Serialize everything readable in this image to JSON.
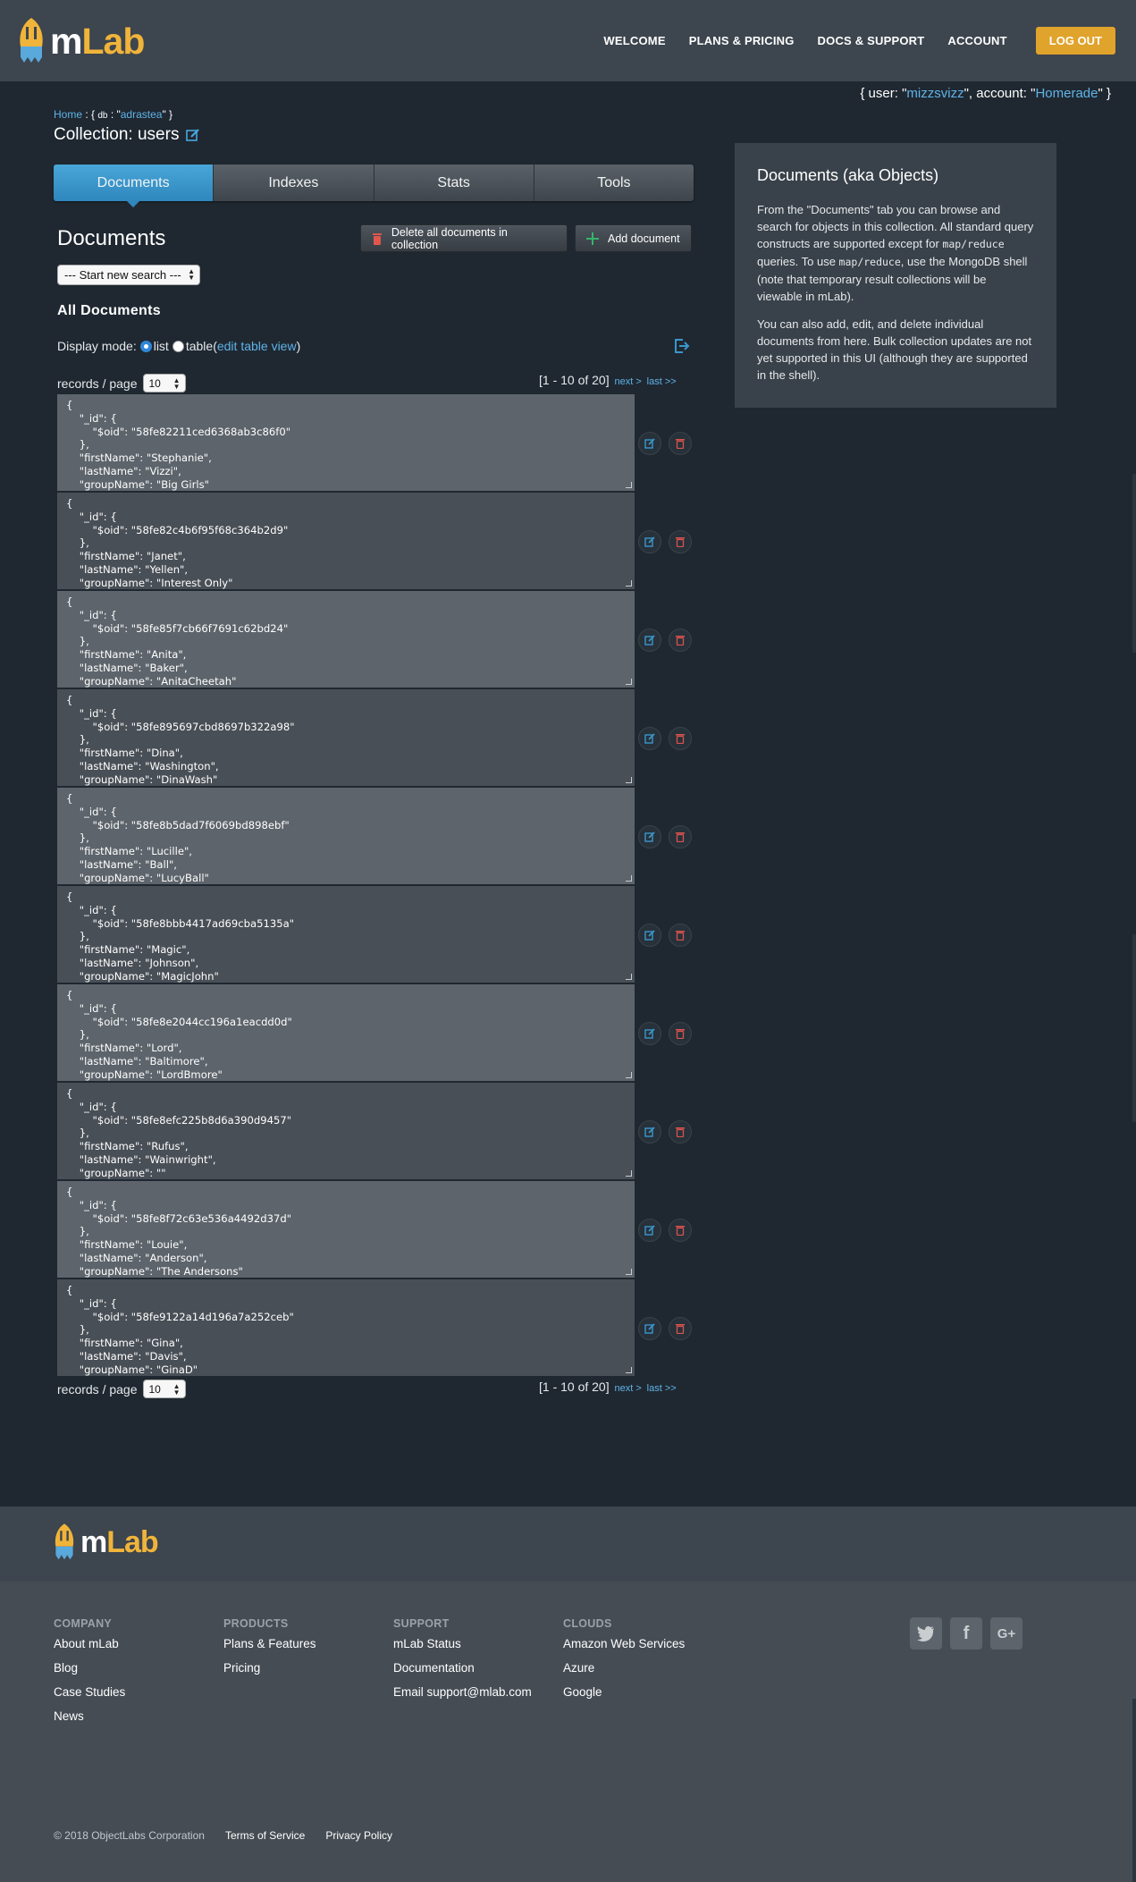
{
  "header": {
    "logo_m": "m",
    "logo_lab": "Lab",
    "nav": [
      "WELCOME",
      "PLANS & PRICING",
      "DOCS & SUPPORT",
      "ACCOUNT"
    ],
    "logout": "LOG OUT"
  },
  "user_line": {
    "prefix": "{ user: \"",
    "user": "mizzsvizz",
    "middle": "\", account: \"",
    "account": "Homerade",
    "suffix": "\" }"
  },
  "breadcrumb": {
    "home": "Home",
    "sep": " : { ",
    "db_label": "db",
    "db_mid": " : \"",
    "db": "adrastea",
    "end": "\" }"
  },
  "collection_title": "Collection: users",
  "tabs": [
    {
      "label": "Documents",
      "active": true
    },
    {
      "label": "Indexes",
      "active": false
    },
    {
      "label": "Stats",
      "active": false
    },
    {
      "label": "Tools",
      "active": false
    }
  ],
  "documents_heading": "Documents",
  "buttons": {
    "delete_all": "Delete all documents in collection",
    "add_document": "Add document"
  },
  "search_select": "--- Start new search ---",
  "all_documents": "All Documents",
  "display_mode": {
    "label": "Display mode:",
    "list": "list",
    "table": "table",
    "open_paren": " (",
    "edit_table_view": "edit table view",
    "close_paren": ")"
  },
  "records_per_page": {
    "label": "records / page",
    "value": "10"
  },
  "pager": {
    "range": "[1 - 10 of 20]",
    "next": "next >",
    "last": "last >>"
  },
  "documents": [
    {
      "oid": "58fe82211ced6368ab3c86f0",
      "firstName": "Stephanie",
      "lastName": "Vizzi",
      "groupName": "Big Girls"
    },
    {
      "oid": "58fe82c4b6f95f68c364b2d9",
      "firstName": "Janet",
      "lastName": "Yellen",
      "groupName": "Interest Only"
    },
    {
      "oid": "58fe85f7cb66f7691c62bd24",
      "firstName": "Anita",
      "lastName": "Baker",
      "groupName": "AnitaCheetah"
    },
    {
      "oid": "58fe895697cbd8697b322a98",
      "firstName": "Dina",
      "lastName": "Washington",
      "groupName": "DinaWash"
    },
    {
      "oid": "58fe8b5dad7f6069bd898ebf",
      "firstName": "Lucille",
      "lastName": "Ball",
      "groupName": "LucyBall"
    },
    {
      "oid": "58fe8bbb4417ad69cba5135a",
      "firstName": "Magic",
      "lastName": "Johnson",
      "groupName": "MagicJohn"
    },
    {
      "oid": "58fe8e2044cc196a1eacdd0d",
      "firstName": "Lord",
      "lastName": "Baltimore",
      "groupName": "LordBmore"
    },
    {
      "oid": "58fe8efc225b8d6a390d9457",
      "firstName": "Rufus",
      "lastName": "Wainwright",
      "groupName": ""
    },
    {
      "oid": "58fe8f72c63e536a4492d37d",
      "firstName": "Louie",
      "lastName": "Anderson",
      "groupName": "The Andersons"
    },
    {
      "oid": "58fe9122a14d196a7a252ceb",
      "firstName": "Gina",
      "lastName": "Davis",
      "groupName": "GinaD"
    }
  ],
  "sidebar": {
    "title": "Documents (aka Objects)",
    "p1_a": "From the \"Documents\" tab you can browse and search for objects in this collection. All standard query constructs are supported except for ",
    "p1_code1": "map/reduce",
    "p1_b": " queries. To use ",
    "p1_code2": "map/reduce",
    "p1_c": ", use the MongoDB shell (note that temporary result collections will be viewable in mLab).",
    "p2": "You can also add, edit, and delete individual documents from here. Bulk collection updates are not yet supported in this UI (although they are supported in the shell)."
  },
  "footer": {
    "columns": [
      {
        "title": "COMPANY",
        "links": [
          "About mLab",
          "Blog",
          "Case Studies",
          "News"
        ]
      },
      {
        "title": "PRODUCTS",
        "links": [
          "Plans & Features",
          "Pricing"
        ]
      },
      {
        "title": "SUPPORT",
        "links": [
          "mLab Status",
          "Documentation",
          "Email support@mlab.com"
        ]
      },
      {
        "title": "CLOUDS",
        "links": [
          "Amazon Web Services",
          "Azure",
          "Google"
        ]
      }
    ],
    "social": [
      "twitter-icon",
      "facebook-icon",
      "google-plus-icon"
    ],
    "copyright": "© 2018 ObjectLabs Corporation",
    "terms": "Terms of Service",
    "privacy": "Privacy Policy"
  },
  "colors": {
    "accent": "#e0a32b",
    "tab_active": "#3a97cb",
    "link": "#5fb3e8",
    "background": "#1f2831"
  }
}
